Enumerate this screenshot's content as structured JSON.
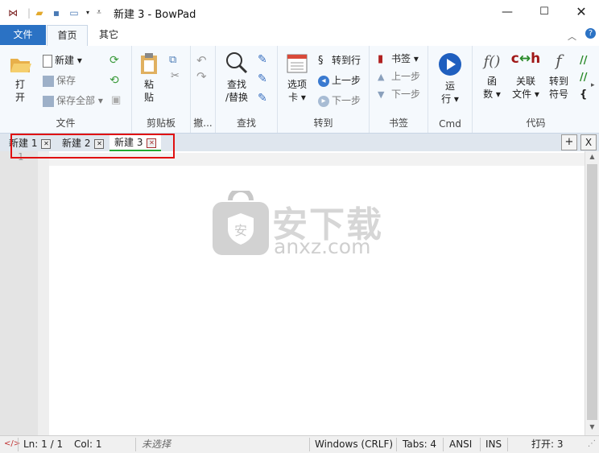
{
  "window": {
    "title": "新建 3 - BowPad"
  },
  "ribbon_tabs": {
    "file": "文件",
    "home": "首页",
    "other": "其它"
  },
  "groups": {
    "file": {
      "label": "文件",
      "open": [
        "打",
        "开"
      ],
      "new": "新建",
      "save": "保存",
      "save_all": "保存全部"
    },
    "clipboard": {
      "label": "剪贴板",
      "paste": [
        "粘",
        "贴"
      ]
    },
    "undo": {
      "label": "撤..."
    },
    "find": {
      "label": "查找",
      "find_replace": [
        "查找",
        "/替换"
      ]
    },
    "goto": {
      "label": "转到",
      "options": [
        "选项",
        "卡"
      ],
      "goto_line": "转到行",
      "prev": "上一步",
      "next": "下一步"
    },
    "bookmarks": {
      "label": "书签",
      "bookmark": "书签",
      "prev": "上一步",
      "next": "下一步"
    },
    "cmd": {
      "label": "Cmd",
      "run": [
        "运",
        "行"
      ]
    },
    "code": {
      "label": "代码",
      "functions": [
        "函",
        "数"
      ],
      "related_files": [
        "关联",
        "文件"
      ],
      "goto_symbol": [
        "转到",
        "符号"
      ]
    }
  },
  "doc_tabs": [
    "新建 1",
    "新建 2",
    "新建 3"
  ],
  "active_tab_index": 2,
  "editor": {
    "line_numbers": [
      "1"
    ],
    "watermark_cn": "安下载",
    "watermark_en": "anxz.com"
  },
  "status": {
    "position": "Ln: 1 / 1",
    "column": "Col: 1",
    "selection": "未选择",
    "eol": "Windows (CRLF)",
    "tabs": "Tabs: 4",
    "encoding": "ANSI",
    "mode": "INS",
    "open_count": "打开: 3"
  },
  "colors": {
    "accent": "#2b72c4",
    "highlight_box": "#e01010",
    "active_tab_underline": "#22aa33"
  }
}
